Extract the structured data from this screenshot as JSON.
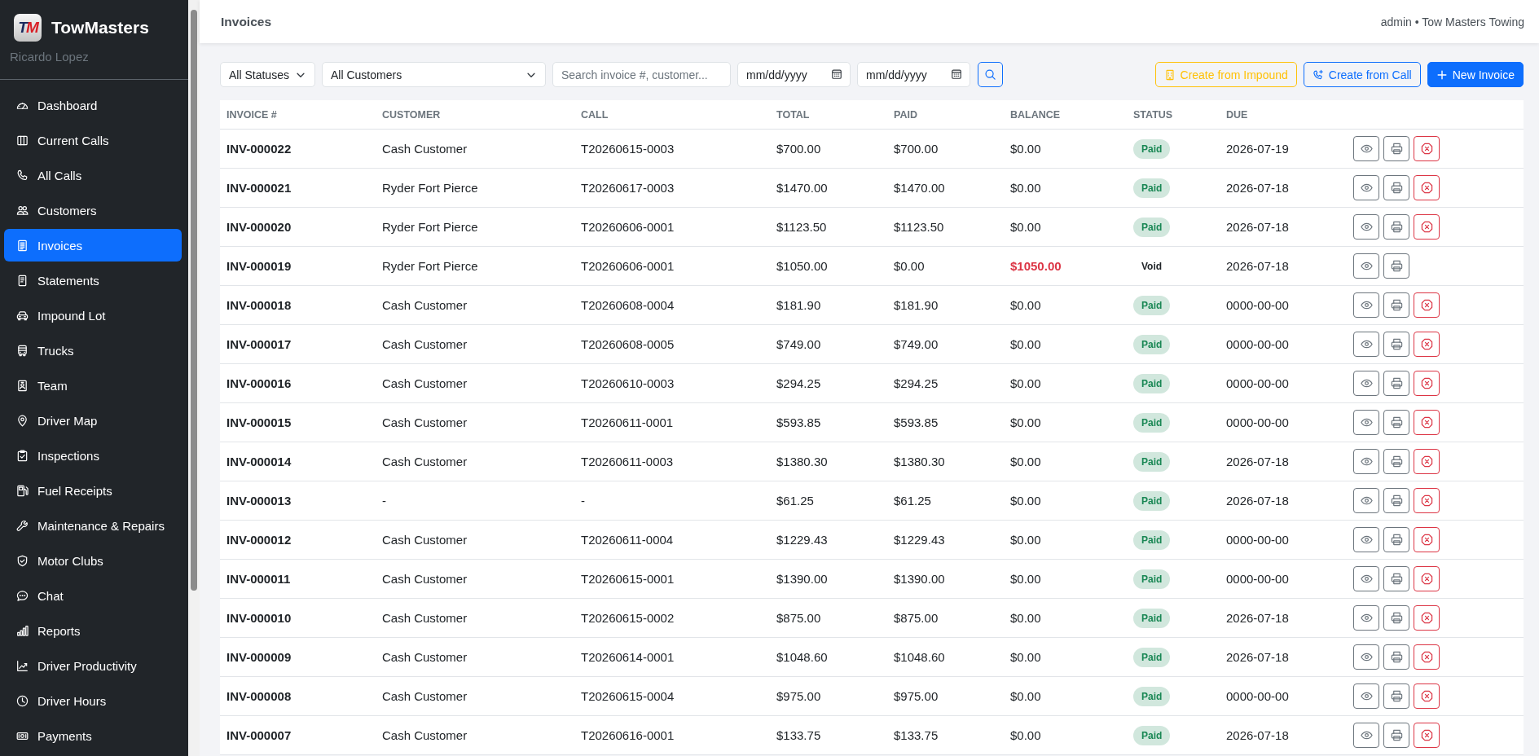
{
  "sidebar": {
    "logo": {
      "text": "TM"
    },
    "brand": "TowMasters",
    "user": "Ricardo Lopez",
    "items": [
      {
        "label": "Dashboard",
        "selected": false
      },
      {
        "label": "Current Calls",
        "selected": false
      },
      {
        "label": "All Calls",
        "selected": false
      },
      {
        "label": "Customers",
        "selected": false
      },
      {
        "label": "Invoices",
        "selected": true
      },
      {
        "label": "Statements",
        "selected": false
      },
      {
        "label": "Impound Lot",
        "selected": false
      },
      {
        "label": "Trucks",
        "selected": false
      },
      {
        "label": "Team",
        "selected": false
      },
      {
        "label": "Driver Map",
        "selected": false
      },
      {
        "label": "Inspections",
        "selected": false
      },
      {
        "label": "Fuel Receipts",
        "selected": false
      },
      {
        "label": "Maintenance & Repairs",
        "selected": false
      },
      {
        "label": "Motor Clubs",
        "selected": false
      },
      {
        "label": "Chat",
        "selected": false
      },
      {
        "label": "Reports",
        "selected": false
      },
      {
        "label": "Driver Productivity",
        "selected": false
      },
      {
        "label": "Driver Hours",
        "selected": false
      },
      {
        "label": "Payments",
        "selected": false
      }
    ]
  },
  "header": {
    "title": "Invoices",
    "account": "admin • Tow Masters Towing"
  },
  "filters": {
    "status_select": "All Statuses",
    "customer_select": "All Customers",
    "search": {
      "placeholder": "Search invoice #, customer..."
    },
    "date_from": {
      "placeholder": "mm/dd/yyyy"
    },
    "date_to": {
      "placeholder": "mm/dd/yyyy"
    }
  },
  "actions": [
    {
      "label": "Create from Impound",
      "kind": "impound"
    },
    {
      "label": "Create from Call",
      "kind": "call"
    },
    {
      "label": "New Invoice",
      "kind": "new"
    }
  ],
  "table": {
    "columns": [
      "INVOICE #",
      "CUSTOMER",
      "CALL",
      "TOTAL",
      "PAID",
      "BALANCE",
      "STATUS",
      "DUE"
    ],
    "rows": [
      {
        "invoice": "INV-000022",
        "customer": "Cash Customer",
        "call": "T20260615-0003",
        "total": "$700.00",
        "paid": "$700.00",
        "balance": "$0.00",
        "balance_due": false,
        "status": {
          "label": "Paid",
          "kind": "paid"
        },
        "due": "2026-07-19",
        "cancel_available": true
      },
      {
        "invoice": "INV-000021",
        "customer": "Ryder Fort Pierce",
        "call": "T20260617-0003",
        "total": "$1470.00",
        "paid": "$1470.00",
        "balance": "$0.00",
        "balance_due": false,
        "status": {
          "label": "Paid",
          "kind": "paid"
        },
        "due": "2026-07-18",
        "cancel_available": true
      },
      {
        "invoice": "INV-000020",
        "customer": "Ryder Fort Pierce",
        "call": "T20260606-0001",
        "total": "$1123.50",
        "paid": "$1123.50",
        "balance": "$0.00",
        "balance_due": false,
        "status": {
          "label": "Paid",
          "kind": "paid"
        },
        "due": "2026-07-18",
        "cancel_available": true
      },
      {
        "invoice": "INV-000019",
        "customer": "Ryder Fort Pierce",
        "call": "T20260606-0001",
        "total": "$1050.00",
        "paid": "$0.00",
        "balance": "$1050.00",
        "balance_due": true,
        "status": {
          "label": "Void",
          "kind": "void"
        },
        "due": "2026-07-18",
        "cancel_available": false
      },
      {
        "invoice": "INV-000018",
        "customer": "Cash Customer",
        "call": "T20260608-0004",
        "total": "$181.90",
        "paid": "$181.90",
        "balance": "$0.00",
        "balance_due": false,
        "status": {
          "label": "Paid",
          "kind": "paid"
        },
        "due": "0000-00-00",
        "cancel_available": true
      },
      {
        "invoice": "INV-000017",
        "customer": "Cash Customer",
        "call": "T20260608-0005",
        "total": "$749.00",
        "paid": "$749.00",
        "balance": "$0.00",
        "balance_due": false,
        "status": {
          "label": "Paid",
          "kind": "paid"
        },
        "due": "0000-00-00",
        "cancel_available": true
      },
      {
        "invoice": "INV-000016",
        "customer": "Cash Customer",
        "call": "T20260610-0003",
        "total": "$294.25",
        "paid": "$294.25",
        "balance": "$0.00",
        "balance_due": false,
        "status": {
          "label": "Paid",
          "kind": "paid"
        },
        "due": "0000-00-00",
        "cancel_available": true
      },
      {
        "invoice": "INV-000015",
        "customer": "Cash Customer",
        "call": "T20260611-0001",
        "total": "$593.85",
        "paid": "$593.85",
        "balance": "$0.00",
        "balance_due": false,
        "status": {
          "label": "Paid",
          "kind": "paid"
        },
        "due": "0000-00-00",
        "cancel_available": true
      },
      {
        "invoice": "INV-000014",
        "customer": "Cash Customer",
        "call": "T20260611-0003",
        "total": "$1380.30",
        "paid": "$1380.30",
        "balance": "$0.00",
        "balance_due": false,
        "status": {
          "label": "Paid",
          "kind": "paid"
        },
        "due": "2026-07-18",
        "cancel_available": true
      },
      {
        "invoice": "INV-000013",
        "customer": "-",
        "call": "-",
        "total": "$61.25",
        "paid": "$61.25",
        "balance": "$0.00",
        "balance_due": false,
        "status": {
          "label": "Paid",
          "kind": "paid"
        },
        "due": "2026-07-18",
        "cancel_available": true
      },
      {
        "invoice": "INV-000012",
        "customer": "Cash Customer",
        "call": "T20260611-0004",
        "total": "$1229.43",
        "paid": "$1229.43",
        "balance": "$0.00",
        "balance_due": false,
        "status": {
          "label": "Paid",
          "kind": "paid"
        },
        "due": "0000-00-00",
        "cancel_available": true
      },
      {
        "invoice": "INV-000011",
        "customer": "Cash Customer",
        "call": "T20260615-0001",
        "total": "$1390.00",
        "paid": "$1390.00",
        "balance": "$0.00",
        "balance_due": false,
        "status": {
          "label": "Paid",
          "kind": "paid"
        },
        "due": "0000-00-00",
        "cancel_available": true
      },
      {
        "invoice": "INV-000010",
        "customer": "Cash Customer",
        "call": "T20260615-0002",
        "total": "$875.00",
        "paid": "$875.00",
        "balance": "$0.00",
        "balance_due": false,
        "status": {
          "label": "Paid",
          "kind": "paid"
        },
        "due": "2026-07-18",
        "cancel_available": true
      },
      {
        "invoice": "INV-000009",
        "customer": "Cash Customer",
        "call": "T20260614-0001",
        "total": "$1048.60",
        "paid": "$1048.60",
        "balance": "$0.00",
        "balance_due": false,
        "status": {
          "label": "Paid",
          "kind": "paid"
        },
        "due": "2026-07-18",
        "cancel_available": true
      },
      {
        "invoice": "INV-000008",
        "customer": "Cash Customer",
        "call": "T20260615-0004",
        "total": "$975.00",
        "paid": "$975.00",
        "balance": "$0.00",
        "balance_due": false,
        "status": {
          "label": "Paid",
          "kind": "paid"
        },
        "due": "0000-00-00",
        "cancel_available": true
      },
      {
        "invoice": "INV-000007",
        "customer": "Cash Customer",
        "call": "T20260616-0001",
        "total": "$133.75",
        "paid": "$133.75",
        "balance": "$0.00",
        "balance_due": false,
        "status": {
          "label": "Paid",
          "kind": "paid"
        },
        "due": "2026-07-18",
        "cancel_available": true
      }
    ]
  }
}
